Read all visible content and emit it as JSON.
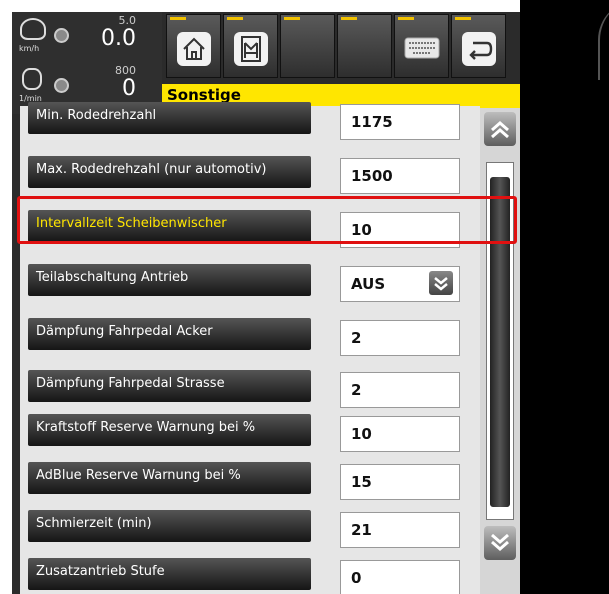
{
  "gauges": {
    "speed": {
      "max": "5.0",
      "value": "0.0",
      "unit": "km/h",
      "icon": "speedometer-icon"
    },
    "rpm": {
      "max": "800",
      "value": "0",
      "unit": "1/min",
      "icon": "engine-icon"
    }
  },
  "toolbar": {
    "buttons": [
      {
        "name": "home-icon"
      },
      {
        "name": "menu-icon"
      },
      {
        "name": "empty"
      },
      {
        "name": "empty"
      },
      {
        "name": "keyboard-icon"
      },
      {
        "name": "back-icon"
      }
    ],
    "accent": "#f0c000"
  },
  "header": {
    "title": "Sonstige",
    "color": "#ffe600"
  },
  "settings": [
    {
      "label": "Min. Rodedrehzahl",
      "value": "1175"
    },
    {
      "label": "Max. Rodedrehzahl (nur automotiv)",
      "value": "1500"
    },
    {
      "label": "Intervallzeit Scheibenwischer",
      "value": "10",
      "highlighted": true
    },
    {
      "label": "Teilabschaltung Antrieb",
      "value": "AUS",
      "dropdown": true
    },
    {
      "label": "Dämpfung Fahrpedal Acker",
      "value": "2"
    },
    {
      "label": "Dämpfung Fahrpedal Strasse",
      "value": "2"
    },
    {
      "label": "Kraftstoff Reserve Warnung bei %",
      "value": "10"
    },
    {
      "label": "AdBlue Reserve Warnung bei %",
      "value": "15"
    },
    {
      "label": "Schmierzeit (min)",
      "value": "21"
    },
    {
      "label": "Zusatzantrieb Stufe",
      "value": "0"
    }
  ],
  "highlight_color": "#e01010"
}
